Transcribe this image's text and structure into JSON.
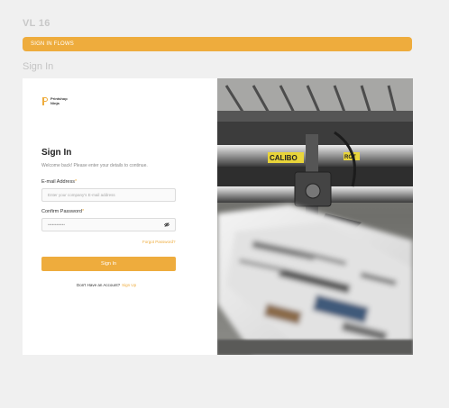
{
  "header": {
    "version": "VL 16",
    "flow_label": "SIGN IN FLOWS",
    "section_title": "Sign In"
  },
  "brand": {
    "name_line1": "Printshop",
    "name_line2": "Ninja",
    "accent_color": "#eeac3d"
  },
  "form": {
    "title": "Sign In",
    "subtitle": "Welcome back! Please enter your details to continue.",
    "email_label": "E-mail Address",
    "email_placeholder": "Enter your company's E-mail address",
    "password_label": "Confirm Password",
    "password_value": "••••••••••••",
    "required_mark": "*",
    "forgot_label": "Forgot Password?",
    "submit_label": "Sign In",
    "signup_prompt": "Don't Have an Account?",
    "signup_link": "Sign Up"
  },
  "image": {
    "label_1": "CALIBO",
    "label_2": "ROT"
  },
  "icons": {
    "password_toggle": "eye-off-icon",
    "logo": "logo-mark"
  }
}
